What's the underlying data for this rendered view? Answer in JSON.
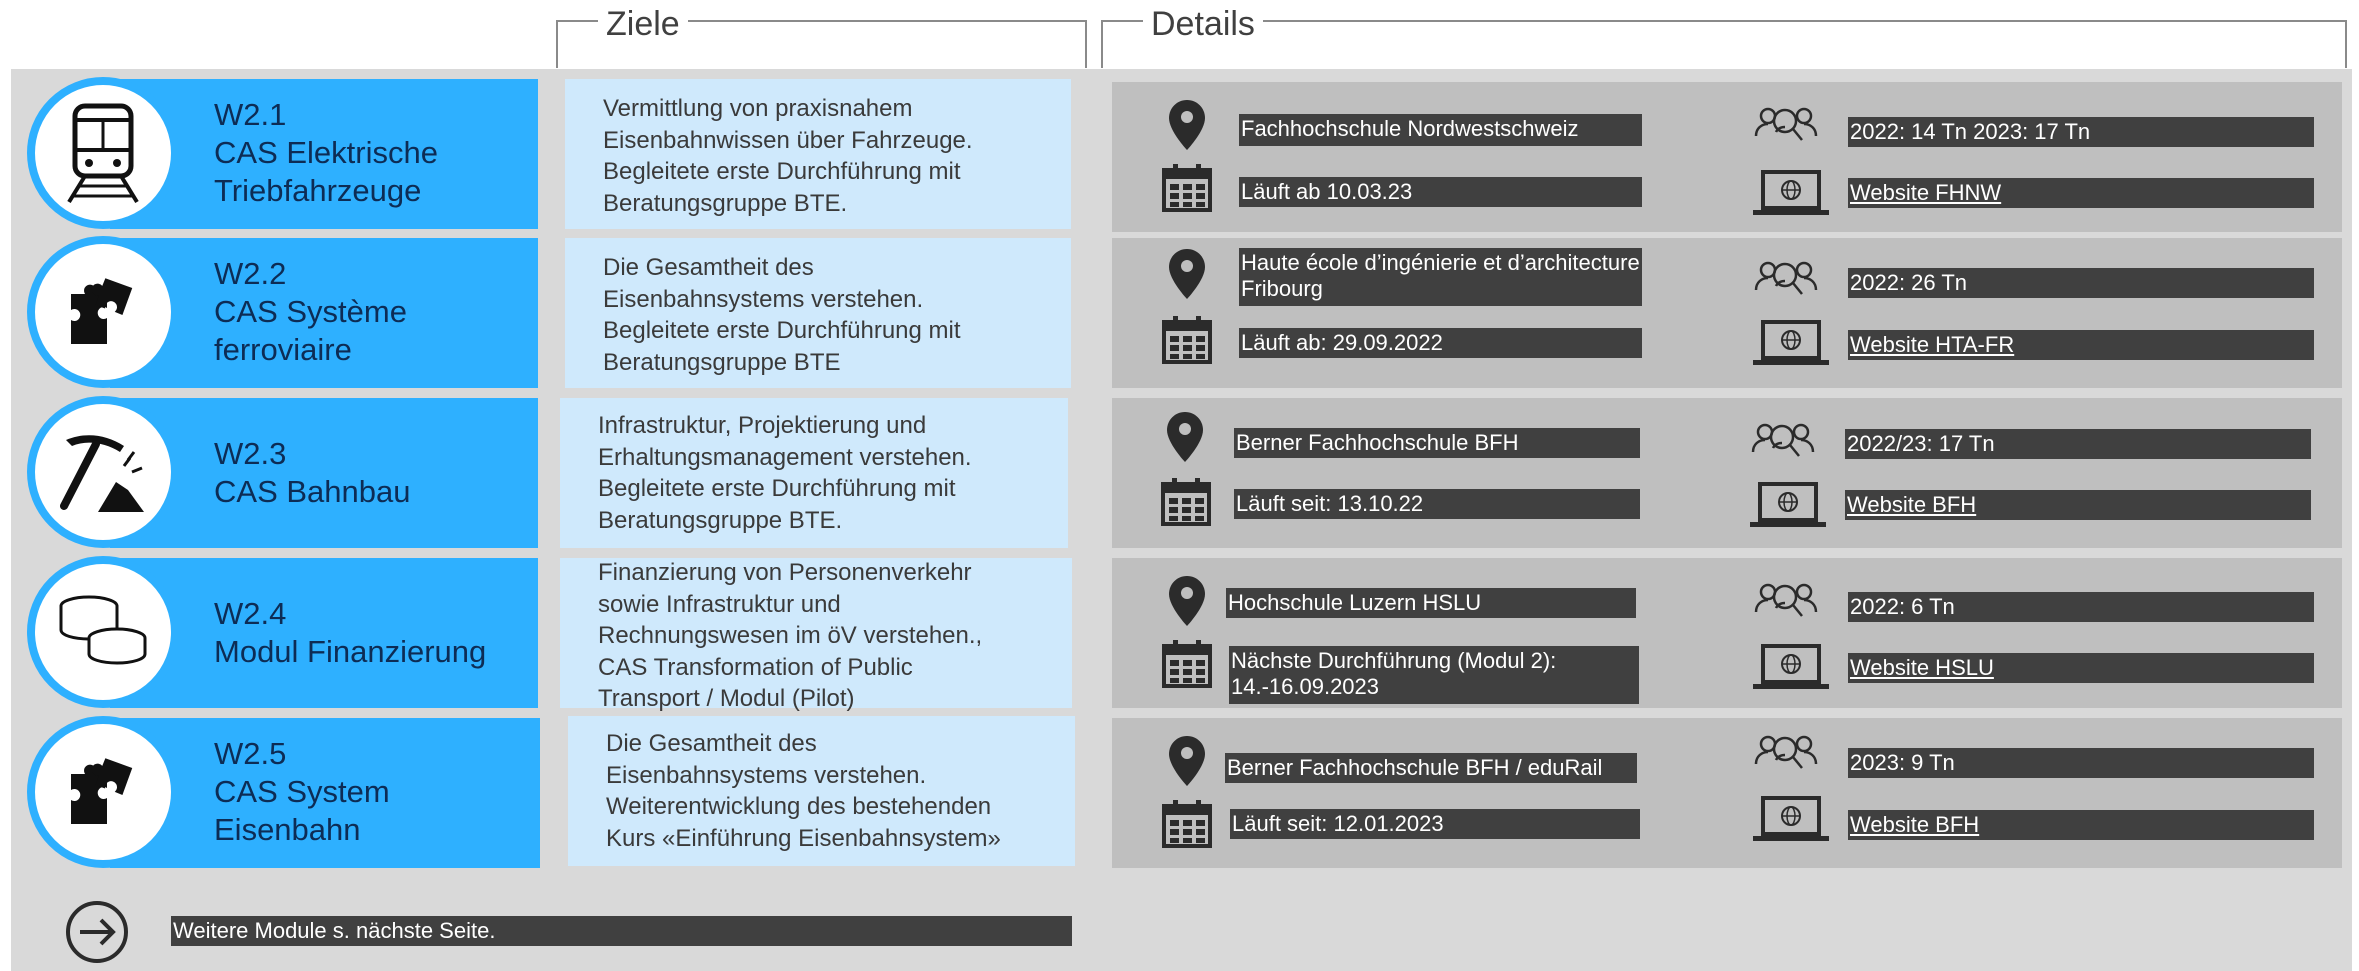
{
  "headers": {
    "goals": "Ziele",
    "details": "Details"
  },
  "rows": [
    {
      "code": "W2.1",
      "title_lines": [
        "CAS Elektrische",
        "Triebfahrzeuge"
      ],
      "icon": "train-icon",
      "goal": "Vermittlung von praxisnahem\nEisenbahnwissen über Fahrzeuge.\nBegleitete erste Durchführung mit\nBeratungsgruppe BTE.",
      "location": "Fachhochschule Nordwestschweiz",
      "participants": "2022: 14 Tn  2023: 17 Tn",
      "date": "Läuft ab 10.03.23",
      "website": "Website FHNW"
    },
    {
      "code": "W2.2",
      "title_lines": [
        "CAS Système",
        "ferroviaire"
      ],
      "icon": "puzzle-icon",
      "goal": "Die Gesamtheit des\nEisenbahnsystems verstehen.\nBegleitete erste Durchführung mit\nBeratungsgruppe BTE",
      "location": "Haute école d’ingénierie et d’architecture\nFribourg",
      "participants": "2022: 26 Tn",
      "date": "Läuft ab: 29.09.2022",
      "website": "Website HTA-FR"
    },
    {
      "code": "W2.3",
      "title_lines": [
        "CAS Bahnbau"
      ],
      "icon": "pickaxe-icon",
      "goal": "Infrastruktur, Projektierung und\nErhaltungsmanagement verstehen.\nBegleitete erste Durchführung mit\nBeratungsgruppe BTE.",
      "location": "Berner Fachhochschule BFH",
      "participants": "2022/23: 17 Tn",
      "date": "Läuft seit: 13.10.22",
      "website": "Website BFH"
    },
    {
      "code": "W2.4",
      "title_lines": [
        "Modul Finanzierung"
      ],
      "icon": "coins-icon",
      "goal": "Finanzierung von Personenverkehr\nsowie Infrastruktur und\nRechnungswesen im öV verstehen.,\nCAS Transformation of Public\nTransport / Modul (Pilot)",
      "location": "Hochschule Luzern HSLU",
      "participants": "2022: 6 Tn",
      "date": "Nächste Durchführung (Modul 2):\n14.-16.09.2023",
      "website": "Website HSLU"
    },
    {
      "code": "W2.5",
      "title_lines": [
        "CAS System",
        "Eisenbahn"
      ],
      "icon": "puzzle-icon",
      "goal": "Die Gesamtheit des\nEisenbahnsystems verstehen.\nWeiterentwicklung des bestehenden\nKurs «Einführung Eisenbahnsystem»",
      "location": "Berner Fachhochschule BFH / eduRail",
      "participants": "2023: 9 Tn",
      "date": "Läuft seit: 12.01.2023",
      "website": "Website BFH"
    }
  ],
  "footer": {
    "text": "Weitere Module s. nächste Seite.",
    "icon": "arrow-right-circle-icon"
  },
  "colors": {
    "accent": "#2eb0ff",
    "goal_bg": "#cfe9fc",
    "detail_bg": "#bfbfbf",
    "bar_bg": "#404040",
    "page_bg": "#d9d9d9"
  }
}
